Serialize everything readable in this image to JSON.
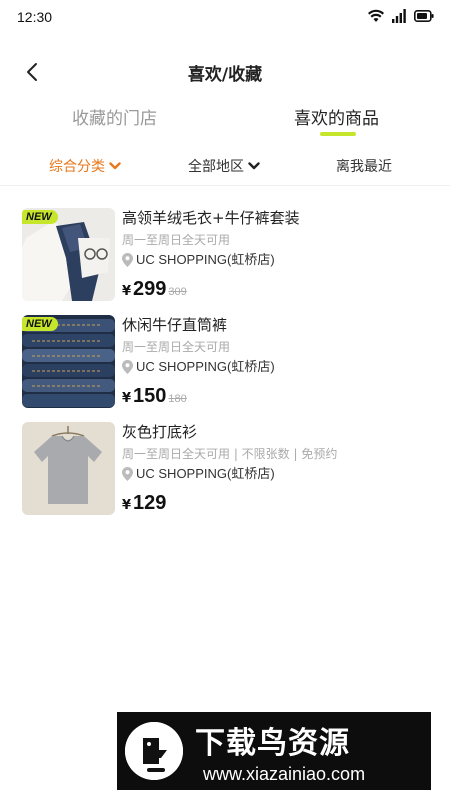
{
  "status": {
    "time": "12:30"
  },
  "nav": {
    "title": "喜欢/收藏"
  },
  "tabs": [
    {
      "label": "收藏的门店",
      "active": false
    },
    {
      "label": "喜欢的商品",
      "active": true
    }
  ],
  "filters": [
    {
      "label": "综合分类",
      "active": true
    },
    {
      "label": "全部地区",
      "active": false
    },
    {
      "label": "离我最近",
      "active": false
    }
  ],
  "products": [
    {
      "badge": "NEW",
      "name": "高领羊绒毛衣+牛仔裤套装",
      "availability": "周一至周日全天可用",
      "store": "UC SHOPPING(虹桥店)",
      "currency": "¥",
      "price": "299",
      "original_price": "309"
    },
    {
      "badge": "NEW",
      "name": "休闲牛仔直筒裤",
      "availability": "周一至周日全天可用",
      "store": "UC SHOPPING(虹桥店)",
      "currency": "¥",
      "price": "150",
      "original_price": "180"
    },
    {
      "name": "灰色打底衫",
      "availability": "周一至周日全天可用 | 不限张数 | 免预约",
      "store": "UC SHOPPING(虹桥店)",
      "currency": "¥",
      "price": "129"
    }
  ],
  "colors": {
    "accent_green": "#c6e62c",
    "accent_orange": "#e8781c"
  },
  "watermark": {
    "title": "下载鸟资源",
    "url": "www.xiazainiao.com"
  }
}
